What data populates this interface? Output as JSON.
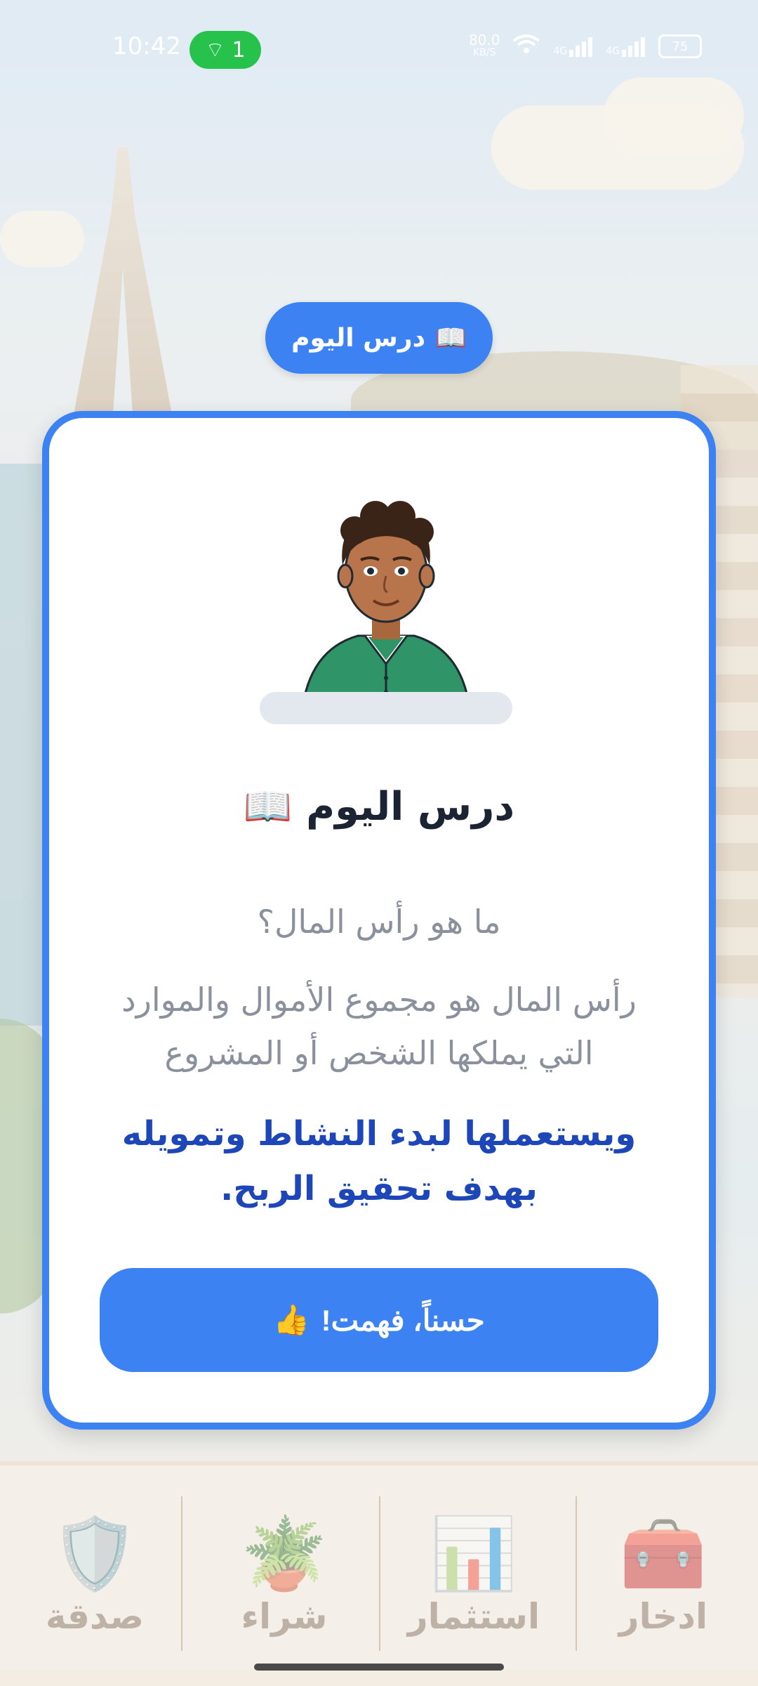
{
  "status_bar": {
    "time": "10:42",
    "hotspot_count": "1",
    "net_speed_value": "80.0",
    "net_speed_unit": "KB/S",
    "signal_1": "4G",
    "signal_2": "4G",
    "battery": "75"
  },
  "header_pill": {
    "icon": "📖",
    "label": "درس اليوم"
  },
  "card": {
    "title_icon": "📖",
    "title": "درس اليوم",
    "question": "ما هو رأس المال؟",
    "description": "رأس المال هو مجموع الأموال والموارد التي يملكها الشخص أو المشروع",
    "highlight": "ويستعملها لبدء النشاط وتمويله بهدف تحقيق الربح.",
    "button_icon": "👍",
    "button_label": "حسناً، فهمت!"
  },
  "bottom_nav": {
    "items": [
      {
        "label": "صدقة",
        "icon": "🛡️"
      },
      {
        "label": "شراء",
        "icon": "🪴"
      },
      {
        "label": "استثمار",
        "icon": "📊"
      },
      {
        "label": "ادخار",
        "icon": "🧰"
      }
    ]
  },
  "colors": {
    "accent": "#3d82f2",
    "highlight_text": "#1d47b8",
    "muted_text": "#8a919c",
    "hotspot_green": "#27c24c"
  }
}
